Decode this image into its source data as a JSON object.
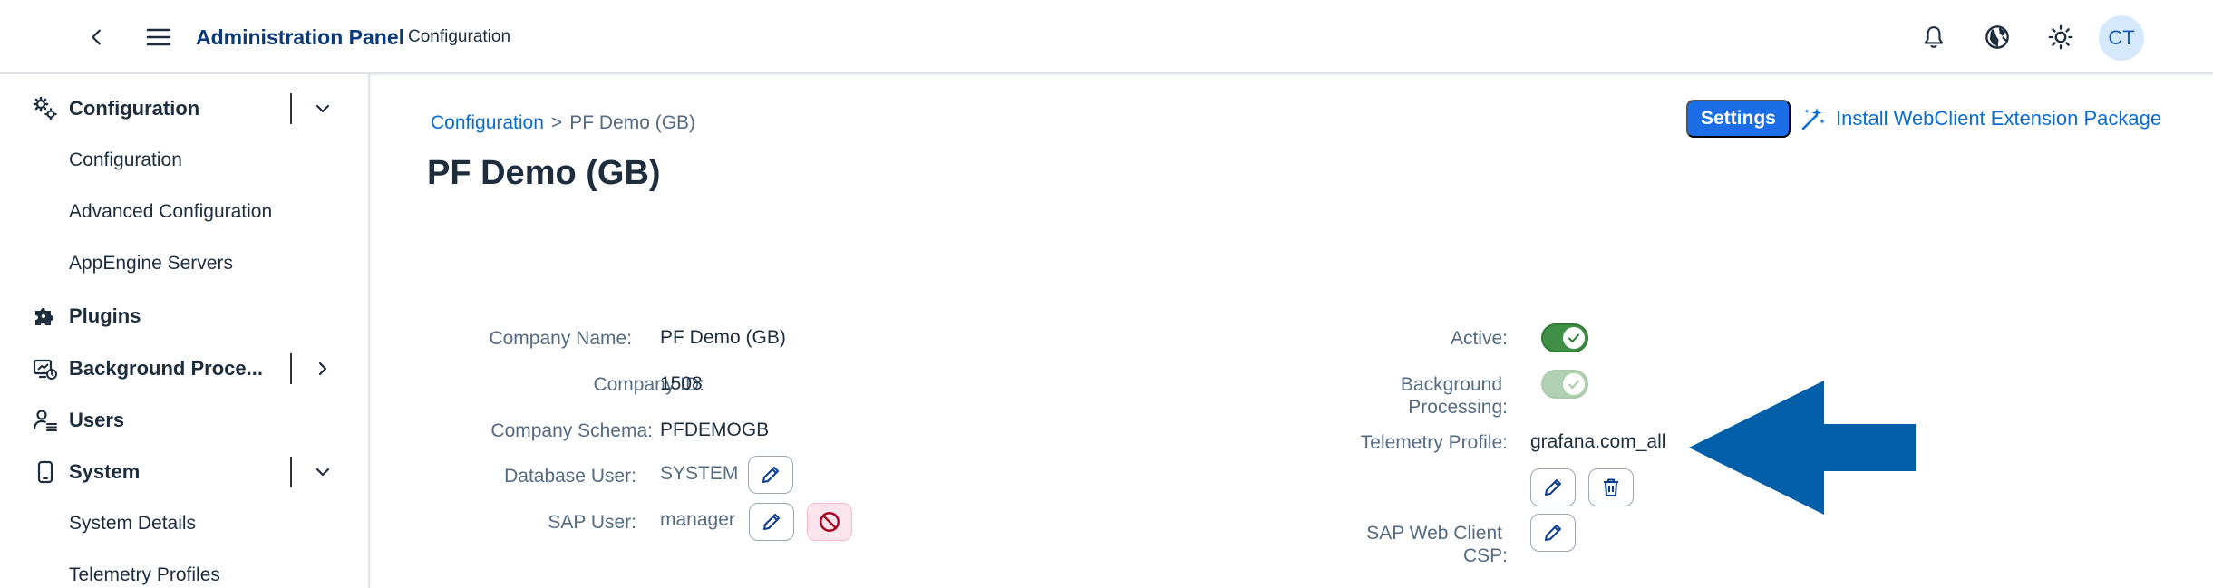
{
  "shell": {
    "title": "Administration Panel",
    "subtitle": "Configuration",
    "avatar_initials": "CT",
    "icons": [
      "back-icon",
      "menu-icon",
      "bell-icon",
      "globe-icon",
      "theme-sun-icon"
    ]
  },
  "sidenav": {
    "items": [
      {
        "label": "Configuration",
        "icon": "gears-icon",
        "expandable": true,
        "expanded": true
      },
      {
        "label": "Plugins",
        "icon": "puzzle-icon",
        "expandable": false
      },
      {
        "label": "Background Proce...",
        "icon": "monitor-process-icon",
        "expandable": true,
        "expanded": false
      },
      {
        "label": "Users",
        "icon": "user-list-icon",
        "expandable": false
      },
      {
        "label": "System",
        "icon": "device-icon",
        "expandable": true,
        "expanded": true
      }
    ],
    "configuration_children": [
      "Configuration",
      "Advanced Configuration",
      "AppEngine Servers"
    ],
    "system_children": [
      "System Details",
      "Telemetry Profiles"
    ]
  },
  "breadcrumb": {
    "parent": "Configuration",
    "separator": ">",
    "current": "PF Demo (GB)"
  },
  "page": {
    "title": "PF Demo (GB)",
    "settings_label": "Settings",
    "install_label": "Install WebClient Extension Package"
  },
  "form_left": [
    {
      "label": "Company Name:",
      "value": "PF Demo (GB)"
    },
    {
      "label": "Company ID:",
      "value": "1508"
    },
    {
      "label": "Company Schema:",
      "value": "PFDEMOGB"
    },
    {
      "label": "Database User:",
      "value": "SYSTEM"
    },
    {
      "label": "SAP User:",
      "value": "manager"
    }
  ],
  "form_right": {
    "active_label": "Active:",
    "active_on": true,
    "bg_label_line1": "Background",
    "bg_label_line2": "Processing:",
    "bg_on": true,
    "telemetry_label": "Telemetry Profile:",
    "telemetry_value": "grafana.com_all",
    "csp_label_line1": "SAP Web Client",
    "csp_label_line2": "CSP:"
  },
  "colors": {
    "accent": "#1b6ee6",
    "link": "#0a6ed1",
    "switch_on": "#3f8f47",
    "annotation_arrow": "#005fa8",
    "reject_bg": "#fce4ec"
  }
}
